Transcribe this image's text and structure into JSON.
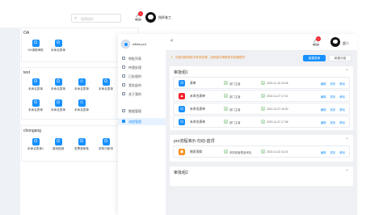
{
  "back_window": {
    "search_placeholder": "搜索插件",
    "notification_count": "1",
    "username": "指挥者工",
    "panels": [
      {
        "title": "OA",
        "apps": [
          {
            "label": "OA请假审批",
            "icon": "app-blue"
          },
          {
            "label": "未命名表单",
            "icon": "app-blue"
          }
        ]
      },
      {
        "title": "test",
        "apps": [
          {
            "label": "未命名表单",
            "icon": "app-blue"
          },
          {
            "label": "未命名表单",
            "icon": "app-blue"
          },
          {
            "label": "未命名表单",
            "icon": "user-blue"
          },
          {
            "label": "未命名表单",
            "icon": "app-blue"
          },
          {
            "label": "未命名表单",
            "icon": "app-blue"
          },
          {
            "label": "未命名表单",
            "icon": "app-blue"
          },
          {
            "label": "未命名表单",
            "icon": "user-blue"
          }
        ]
      },
      {
        "title": "chongang",
        "apps": [
          {
            "label": "未命名表单1",
            "icon": "app-blue"
          },
          {
            "label": "费用报销",
            "icon": "app-blue"
          },
          {
            "label": "发票报审批",
            "icon": "app-blue"
          },
          {
            "label": "采购付款申",
            "icon": "app-blue"
          }
        ]
      }
    ]
  },
  "front_window": {
    "brand": "wflow-pro",
    "nav": [
      {
        "label": "审批列表",
        "active": false
      },
      {
        "label": "待我处理",
        "active": false
      },
      {
        "label": "已处理的",
        "active": false
      },
      {
        "label": "我发起的",
        "active": false
      },
      {
        "label": "关于我的",
        "active": false
      },
      {
        "label": "数据管理",
        "active": false
      },
      {
        "label": "流程管理",
        "active": true
      }
    ],
    "header": {
      "back": "<",
      "notification_count": "1",
      "username": "超人"
    },
    "notice": "在新流程审批中有效处理，如有疑问请联系系统管理员",
    "new_button": "新建表单",
    "other_button": "新建分组",
    "groups": [
      {
        "title": "审批组1",
        "rows": [
          {
            "name": "表单",
            "icon_color": "#1890ff",
            "tag": "S",
            "dept": "部门主管",
            "user": "S",
            "time": "2022-11-10 10:45",
            "actions": [
              "编辑",
              "发布",
              "移动"
            ]
          },
          {
            "name": "未命名表单",
            "icon_color": "#f5222d",
            "tag": "S",
            "dept": "部门主管",
            "user": "S",
            "time": "2022-11-07 17:21",
            "actions": [
              "编辑",
              "发布",
              "移动"
            ]
          },
          {
            "name": "未命名表单",
            "icon_color": "#1890ff",
            "tag": "S",
            "dept": "部门主管",
            "user": "S",
            "time": "2022-11-07 16:30",
            "actions": [
              "编辑",
              "发布",
              "移动"
            ]
          },
          {
            "name": "未命名表单",
            "icon_color": "#1890ff",
            "tag": "S",
            "dept": "部门主管",
            "user": "S",
            "time": "2022-11-07 17:38",
            "actions": [
              "编辑",
              "发布",
              "移动"
            ]
          }
        ]
      },
      {
        "title": "pro流程演示-勿动-首顶",
        "rows": [
          {
            "name": "物资采购",
            "icon_color": "#fa8c16",
            "tag": "S",
            "dept": "采购部管理者审批",
            "user": "S",
            "time": "2022-11-02 11:24",
            "actions": [
              "编辑",
              "发布",
              "移动"
            ]
          }
        ]
      },
      {
        "title": "审批组2",
        "rows": []
      }
    ]
  }
}
